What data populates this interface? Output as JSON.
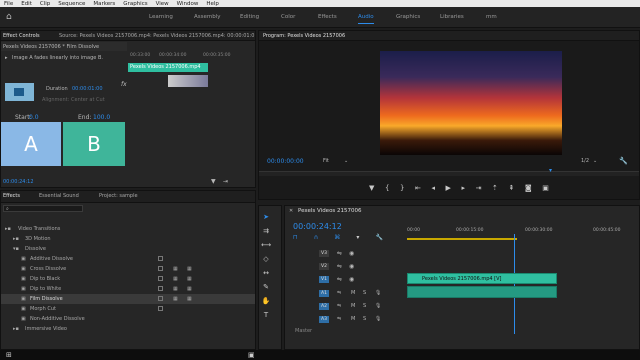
{
  "menu": [
    "File",
    "Edit",
    "Clip",
    "Sequence",
    "Markers",
    "Graphics",
    "View",
    "Window",
    "Help"
  ],
  "workspaces": [
    {
      "label": "Learning",
      "active": false
    },
    {
      "label": "Assembly",
      "active": false
    },
    {
      "label": "Editing",
      "active": false
    },
    {
      "label": "Color",
      "active": false
    },
    {
      "label": "Effects",
      "active": false
    },
    {
      "label": "Audio",
      "active": true
    },
    {
      "label": "Graphics",
      "active": false
    },
    {
      "label": "Libraries",
      "active": false
    },
    {
      "label": "mm",
      "active": false
    }
  ],
  "effect_controls": {
    "tab_active": "Effect Controls",
    "tab_source": "Source: Pexels Videos 2157006.mp4: Pexels Videos 2157006.mp4: 00:00:01:0",
    "clip_title": "Pexels Videos 2157006 * Film Dissolve",
    "description": "Image A fades linearly into image B.",
    "duration_label": "Duration",
    "duration_value": "00:00:01:00",
    "alignment_label": "Alignment:",
    "alignment_value": "Center at Cut",
    "start_label": "Start:",
    "start_value": "0.0",
    "end_label": "End:",
    "end_value": "100.0",
    "tile_a": "A",
    "tile_b": "B",
    "ruler_times": [
      "00:33:00",
      "00:00:34:00",
      "00:00:35:00"
    ],
    "clip_label": "Pexels Videos 2157006.mp4",
    "fx_label": "fx",
    "timecode": "00:00:24:12"
  },
  "program": {
    "title": "Program: Pexels Videos 2157006",
    "timecode": "00:00:00:00",
    "fit": "Fit",
    "resolution": "1/2",
    "end_timecode": "00:00:30:00",
    "transport": [
      "marker-icon",
      "in-point-icon",
      "out-point-icon",
      "go-to-in-icon",
      "step-back-icon",
      "play-icon",
      "step-forward-icon",
      "go-to-out-icon",
      "lift-icon",
      "extract-icon",
      "export-frame-icon",
      "button-editor-icon"
    ]
  },
  "effects_panel": {
    "tabs": [
      "Effects",
      "Essential Sound",
      "Project: sample"
    ],
    "items": [
      {
        "label": "Video Transitions",
        "indent": 0,
        "kind": "folder"
      },
      {
        "label": "3D Motion",
        "indent": 1,
        "kind": "folder"
      },
      {
        "label": "Dissolve",
        "indent": 1,
        "kind": "folder"
      },
      {
        "label": "Additive Dissolve",
        "indent": 2,
        "kind": "fx"
      },
      {
        "label": "Cross Dissolve",
        "indent": 2,
        "kind": "fx"
      },
      {
        "label": "Dip to Black",
        "indent": 2,
        "kind": "fx"
      },
      {
        "label": "Dip to White",
        "indent": 2,
        "kind": "fx"
      },
      {
        "label": "Film Dissolve",
        "indent": 2,
        "kind": "fx",
        "selected": true
      },
      {
        "label": "Morph Cut",
        "indent": 2,
        "kind": "fx"
      },
      {
        "label": "Non-Additive Dissolve",
        "indent": 2,
        "kind": "fx"
      },
      {
        "label": "Immersive Video",
        "indent": 1,
        "kind": "folder"
      }
    ]
  },
  "timeline": {
    "title": "Pexels Videos 2157006",
    "timecode": "00:00:24:12",
    "ruler": [
      "00:00",
      "00:00:15:00",
      "00:00:30:00",
      "00:00:45:00"
    ],
    "video_tracks": [
      "V3",
      "V2",
      "V1"
    ],
    "audio_tracks": [
      "A1",
      "A2",
      "A3"
    ],
    "video_clip_label": "Pexels Videos 2157006.mp4 [V]",
    "footer": "Master"
  },
  "colors": {
    "accent": "#2d8ceb",
    "clip": "#2fbfa0",
    "panel": "#262626",
    "workspace_bg": "#232323"
  }
}
